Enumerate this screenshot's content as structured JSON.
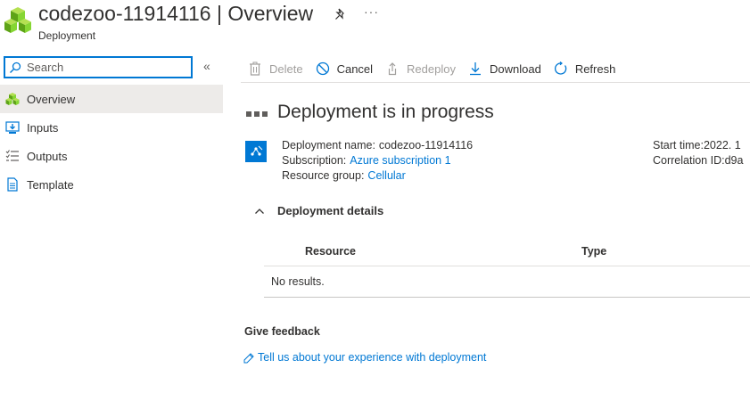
{
  "header": {
    "resource_name": "codezoo-11914116",
    "separator": "|",
    "page": "Overview",
    "subtitle": "Deployment",
    "more": "···"
  },
  "sidebar": {
    "search_placeholder": "Search",
    "collapse": "«",
    "items": [
      {
        "label": "Overview",
        "icon": "overview-icon",
        "active": true
      },
      {
        "label": "Inputs",
        "icon": "inputs-icon"
      },
      {
        "label": "Outputs",
        "icon": "outputs-icon"
      },
      {
        "label": "Template",
        "icon": "template-icon"
      }
    ]
  },
  "toolbar": {
    "delete": "Delete",
    "cancel": "Cancel",
    "redeploy": "Redeploy",
    "download": "Download",
    "refresh": "Refresh"
  },
  "status": {
    "title": "Deployment is in progress"
  },
  "info": {
    "deployment_name_label": "Deployment name:",
    "deployment_name": "codezoo-11914116",
    "subscription_label": "Subscription:",
    "subscription": "Azure subscription 1",
    "resource_group_label": "Resource group:",
    "resource_group": "Cellular",
    "start_time_label": "Start time:",
    "start_time": "2022. 1",
    "correlation_label": "Correlation ID:",
    "correlation": "d9a"
  },
  "details": {
    "label": "Deployment details",
    "columns": [
      "Resource",
      "Type"
    ],
    "empty": "No results."
  },
  "feedback": {
    "title": "Give feedback",
    "link": "Tell us about your experience with deployment"
  },
  "colors": {
    "accent": "#0078d4",
    "nav_active": "#edebe9",
    "logo_green": "#7fba00"
  }
}
